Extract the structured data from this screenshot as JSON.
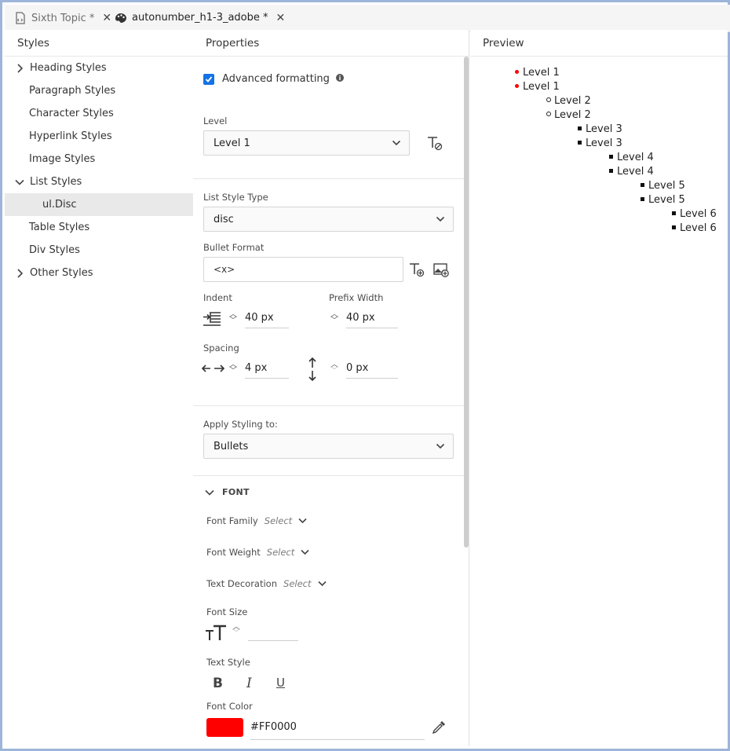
{
  "tabs": [
    {
      "label": "Sixth Topic *",
      "icon": "document-code-icon"
    },
    {
      "label": "autonumber_h1-3_adobe *",
      "icon": "palette-icon"
    }
  ],
  "styles_panel": {
    "title": "Styles",
    "items": [
      {
        "label": "Heading Styles",
        "expandable": true,
        "expanded": false
      },
      {
        "label": "Paragraph Styles"
      },
      {
        "label": "Character Styles"
      },
      {
        "label": "Hyperlink Styles"
      },
      {
        "label": "Image Styles"
      },
      {
        "label": "List Styles",
        "expandable": true,
        "expanded": true
      },
      {
        "label": "ul.Disc",
        "selected": true
      },
      {
        "label": "Table Styles"
      },
      {
        "label": "Div Styles"
      },
      {
        "label": "Other Styles",
        "expandable": true,
        "expanded": false
      }
    ]
  },
  "properties_panel": {
    "title": "Properties",
    "advanced_formatting": {
      "label": "Advanced formatting",
      "checked": true
    },
    "level": {
      "label": "Level",
      "value": "Level 1"
    },
    "list_style_type": {
      "label": "List Style Type",
      "value": "disc"
    },
    "bullet_format": {
      "label": "Bullet Format",
      "value": "<x>"
    },
    "indent": {
      "label": "Indent",
      "value": "40 px"
    },
    "prefix_width": {
      "label": "Prefix Width",
      "value": "40 px"
    },
    "spacing": {
      "label": "Spacing",
      "horizontal": "4 px",
      "vertical": "0 px"
    },
    "apply_styling": {
      "label": "Apply Styling to:",
      "value": "Bullets"
    },
    "font_section": {
      "title": "FONT",
      "font_family": {
        "label": "Font Family",
        "placeholder": "Select"
      },
      "font_weight": {
        "label": "Font Weight",
        "placeholder": "Select"
      },
      "text_decoration": {
        "label": "Text Decoration",
        "placeholder": "Select"
      },
      "font_size": {
        "label": "Font Size"
      },
      "text_style": {
        "label": "Text Style",
        "bold": "B",
        "italic": "I",
        "underline": "U"
      },
      "font_color": {
        "label": "Font Color",
        "value": "#FF0000",
        "swatch": "#FF0000"
      }
    }
  },
  "preview_panel": {
    "title": "Preview",
    "items": [
      {
        "label": "Level 1",
        "level": 1
      },
      {
        "label": "Level 1",
        "level": 1
      },
      {
        "label": "Level 2",
        "level": 2
      },
      {
        "label": "Level 2",
        "level": 2
      },
      {
        "label": "Level 3",
        "level": 3
      },
      {
        "label": "Level 3",
        "level": 3
      },
      {
        "label": "Level 4",
        "level": 4
      },
      {
        "label": "Level 4",
        "level": 4
      },
      {
        "label": "Level 5",
        "level": 5
      },
      {
        "label": "Level 5",
        "level": 5
      },
      {
        "label": "Level 6",
        "level": 6
      },
      {
        "label": "Level 6",
        "level": 6
      }
    ]
  },
  "colors": {
    "accent": "#1473e6",
    "bullet_level1": "#FF0000"
  }
}
